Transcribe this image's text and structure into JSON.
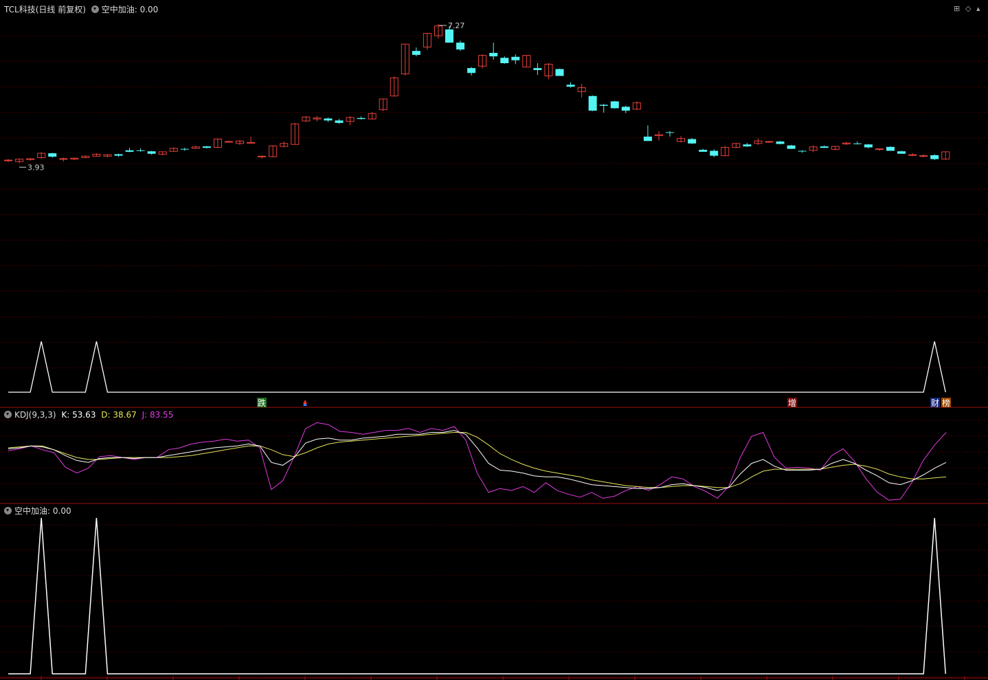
{
  "main": {
    "stock_name": "TCL科技",
    "period": "(日线 前复权)",
    "indicator_label": "空中加油",
    "indicator_value": ": 0.00",
    "high_label": "7.27",
    "low_label": "3.93",
    "markers": {
      "die": "跌",
      "zeng": "增",
      "cai": "财",
      "bang": "榜"
    }
  },
  "kdj": {
    "name": "KDJ(9,3,3)",
    "k_label": "K: 53.63",
    "d_label": "D: 38.67",
    "j_label": "J: 83.55",
    "k": 53.63,
    "d": 38.67,
    "j": 83.55
  },
  "lower": {
    "name": "空中加油",
    "value": ": 0.00"
  },
  "colors": {
    "background": "#000000",
    "up": "#e8413a",
    "down": "#54f4f4",
    "grid": "#7a0000",
    "divider": "#a01010",
    "k_line": "#ffffff",
    "d_line": "#e6e65a",
    "j_line": "#e23ce2",
    "signal": "#ffffff"
  },
  "chart_data": [
    {
      "type": "candlestick",
      "title": "TCL科技(日线 前复权)",
      "ohlc": [
        [
          4.41,
          4.44,
          4.38,
          4.42
        ],
        [
          4.39,
          4.45,
          4.36,
          4.44
        ],
        [
          4.43,
          4.46,
          4.41,
          4.45
        ],
        [
          4.47,
          4.58,
          4.45,
          4.56
        ],
        [
          4.56,
          4.57,
          4.47,
          4.49
        ],
        [
          4.45,
          4.47,
          4.39,
          4.45
        ],
        [
          4.44,
          4.47,
          4.42,
          4.46
        ],
        [
          4.47,
          4.51,
          4.46,
          4.5
        ],
        [
          4.5,
          4.56,
          4.49,
          4.54
        ],
        [
          4.5,
          4.54,
          4.48,
          4.53
        ],
        [
          4.54,
          4.55,
          4.49,
          4.51
        ],
        [
          4.62,
          4.67,
          4.58,
          4.59
        ],
        [
          4.62,
          4.66,
          4.59,
          4.61
        ],
        [
          4.6,
          4.61,
          4.53,
          4.55
        ],
        [
          4.54,
          4.6,
          4.52,
          4.59
        ],
        [
          4.6,
          4.68,
          4.59,
          4.66
        ],
        [
          4.65,
          4.67,
          4.61,
          4.64
        ],
        [
          4.66,
          4.71,
          4.65,
          4.69
        ],
        [
          4.7,
          4.71,
          4.66,
          4.67
        ],
        [
          4.68,
          4.86,
          4.67,
          4.85
        ],
        [
          4.8,
          4.82,
          4.79,
          4.8
        ],
        [
          4.76,
          4.83,
          4.73,
          4.81
        ],
        [
          4.77,
          4.9,
          4.76,
          4.78
        ],
        [
          4.5,
          4.51,
          4.45,
          4.5
        ],
        [
          4.49,
          4.72,
          4.48,
          4.71
        ],
        [
          4.7,
          4.8,
          4.68,
          4.76
        ],
        [
          4.74,
          5.18,
          4.74,
          5.16
        ],
        [
          5.22,
          5.32,
          5.2,
          5.3
        ],
        [
          5.26,
          5.32,
          5.21,
          5.28
        ],
        [
          5.27,
          5.29,
          5.2,
          5.23
        ],
        [
          5.23,
          5.26,
          5.16,
          5.18
        ],
        [
          5.21,
          5.32,
          5.13,
          5.29
        ],
        [
          5.28,
          5.31,
          5.25,
          5.26
        ],
        [
          5.26,
          5.4,
          5.25,
          5.37
        ],
        [
          5.45,
          5.67,
          5.42,
          5.67
        ],
        [
          5.73,
          6.13,
          5.72,
          6.1
        ],
        [
          6.18,
          6.8,
          6.15,
          6.79
        ],
        [
          6.65,
          6.72,
          6.54,
          6.57
        ],
        [
          6.73,
          7.02,
          6.67,
          7.01
        ],
        [
          6.96,
          7.2,
          6.9,
          7.16
        ],
        [
          7.09,
          7.16,
          6.82,
          6.82
        ],
        [
          6.82,
          6.86,
          6.65,
          6.68
        ],
        [
          6.3,
          6.32,
          6.15,
          6.2
        ],
        [
          6.34,
          6.58,
          6.29,
          6.56
        ],
        [
          6.61,
          6.82,
          6.47,
          6.54
        ],
        [
          6.51,
          6.54,
          6.39,
          6.4
        ],
        [
          6.53,
          6.58,
          6.38,
          6.46
        ],
        [
          6.32,
          6.56,
          6.32,
          6.56
        ],
        [
          6.3,
          6.4,
          6.16,
          6.26
        ],
        [
          6.14,
          6.4,
          6.07,
          6.38
        ],
        [
          6.28,
          6.29,
          6.14,
          6.14
        ],
        [
          5.96,
          6.01,
          5.9,
          5.92
        ],
        [
          5.82,
          5.98,
          5.7,
          5.9
        ],
        [
          5.73,
          5.74,
          5.42,
          5.43
        ],
        [
          5.55,
          5.57,
          5.39,
          5.53
        ],
        [
          5.62,
          5.63,
          5.47,
          5.48
        ],
        [
          5.51,
          5.53,
          5.38,
          5.43
        ],
        [
          5.46,
          5.62,
          5.44,
          5.59
        ],
        [
          4.9,
          5.13,
          4.82,
          4.81
        ],
        [
          4.92,
          5.01,
          4.82,
          4.94
        ],
        [
          4.99,
          5.01,
          4.9,
          4.98
        ],
        [
          4.8,
          4.91,
          4.78,
          4.86
        ],
        [
          4.85,
          4.87,
          4.75,
          4.76
        ],
        [
          4.63,
          4.65,
          4.59,
          4.59
        ],
        [
          4.61,
          4.64,
          4.48,
          4.51
        ],
        [
          4.51,
          4.71,
          4.5,
          4.68
        ],
        [
          4.68,
          4.77,
          4.66,
          4.76
        ],
        [
          4.74,
          4.77,
          4.69,
          4.7
        ],
        [
          4.76,
          4.86,
          4.73,
          4.81
        ],
        [
          4.8,
          4.81,
          4.77,
          4.8
        ],
        [
          4.8,
          4.81,
          4.74,
          4.75
        ],
        [
          4.72,
          4.73,
          4.65,
          4.65
        ],
        [
          4.61,
          4.62,
          4.57,
          4.6
        ],
        [
          4.62,
          4.72,
          4.58,
          4.69
        ],
        [
          4.7,
          4.72,
          4.67,
          4.67
        ],
        [
          4.64,
          4.71,
          4.62,
          4.7
        ],
        [
          4.75,
          4.79,
          4.73,
          4.77
        ],
        [
          4.76,
          4.8,
          4.74,
          4.75
        ],
        [
          4.74,
          4.75,
          4.66,
          4.68
        ],
        [
          4.65,
          4.66,
          4.61,
          4.65
        ],
        [
          4.69,
          4.7,
          4.61,
          4.61
        ],
        [
          4.6,
          4.61,
          4.55,
          4.55
        ],
        [
          4.53,
          4.56,
          4.5,
          4.53
        ],
        [
          4.51,
          4.54,
          4.48,
          4.51
        ],
        [
          4.52,
          4.54,
          4.42,
          4.44
        ],
        [
          4.44,
          4.59,
          4.43,
          4.59
        ]
      ]
    },
    {
      "type": "line",
      "title": "KDJ(9,3,3)",
      "series": [
        {
          "name": "K",
          "values": [
            67,
            68,
            70,
            69,
            66,
            60,
            55,
            53,
            57,
            58,
            58,
            57,
            58,
            58,
            60,
            62,
            64,
            66,
            68,
            69,
            70,
            72,
            70,
            53,
            50,
            58,
            73,
            77,
            78,
            76,
            76,
            78,
            79,
            80,
            82,
            82,
            82,
            84,
            84,
            86,
            82,
            68,
            52,
            45,
            44,
            42,
            39,
            38,
            38,
            36,
            33,
            30,
            29,
            28,
            27,
            26,
            26,
            27,
            30,
            31,
            29,
            27,
            24,
            27,
            41,
            52,
            56,
            49,
            45,
            45,
            45,
            46,
            52,
            56,
            52,
            45,
            39,
            32,
            30,
            34,
            40,
            47,
            53
          ]
        },
        {
          "name": "D",
          "values": [
            68,
            69,
            70,
            70,
            66,
            62,
            58,
            56,
            56,
            57,
            58,
            58,
            58,
            58,
            58,
            59,
            60,
            62,
            64,
            66,
            68,
            70,
            70,
            66,
            61,
            59,
            63,
            68,
            72,
            74,
            75,
            76,
            77,
            78,
            79,
            80,
            81,
            82,
            83,
            84,
            84,
            79,
            71,
            62,
            56,
            51,
            47,
            44,
            42,
            40,
            38,
            35,
            33,
            31,
            29,
            28,
            27,
            27,
            28,
            29,
            29,
            28,
            27,
            27,
            31,
            38,
            44,
            46,
            46,
            46,
            46,
            46,
            48,
            50,
            51,
            49,
            46,
            41,
            38,
            36,
            36,
            37,
            38
          ]
        },
        {
          "name": "J",
          "values": [
            65,
            67,
            70,
            66,
            63,
            48,
            42,
            47,
            59,
            60,
            58,
            56,
            58,
            58,
            66,
            68,
            72,
            74,
            75,
            77,
            75,
            76,
            68,
            25,
            34,
            59,
            88,
            94,
            92,
            85,
            84,
            82,
            84,
            86,
            86,
            88,
            84,
            88,
            86,
            90,
            76,
            42,
            22,
            26,
            24,
            28,
            22,
            32,
            24,
            20,
            17,
            22,
            16,
            18,
            24,
            28,
            24,
            30,
            38,
            36,
            28,
            23,
            16,
            28,
            58,
            80,
            84,
            58,
            47,
            48,
            47,
            45,
            60,
            67,
            54,
            36,
            22,
            14,
            15,
            32,
            55,
            71,
            84
          ]
        }
      ]
    },
    {
      "type": "line",
      "title": "空中加油",
      "series": [
        {
          "name": "空中加油",
          "values": [
            0,
            0,
            0,
            1,
            0,
            0,
            0,
            0,
            1,
            0,
            0,
            0,
            0,
            0,
            0,
            0,
            0,
            0,
            0,
            0,
            0,
            0,
            0,
            0,
            0,
            0,
            0,
            0,
            0,
            0,
            0,
            0,
            0,
            0,
            0,
            0,
            0,
            0,
            0,
            0,
            0,
            0,
            0,
            0,
            0,
            0,
            0,
            0,
            0,
            0,
            0,
            0,
            0,
            0,
            0,
            0,
            0,
            0,
            0,
            0,
            0,
            0,
            0,
            0,
            0,
            0,
            0,
            0,
            0,
            0,
            0,
            0,
            0,
            0,
            0,
            0,
            0,
            0,
            0,
            0,
            0,
            0,
            0,
            0,
            1,
            0
          ]
        }
      ]
    }
  ]
}
